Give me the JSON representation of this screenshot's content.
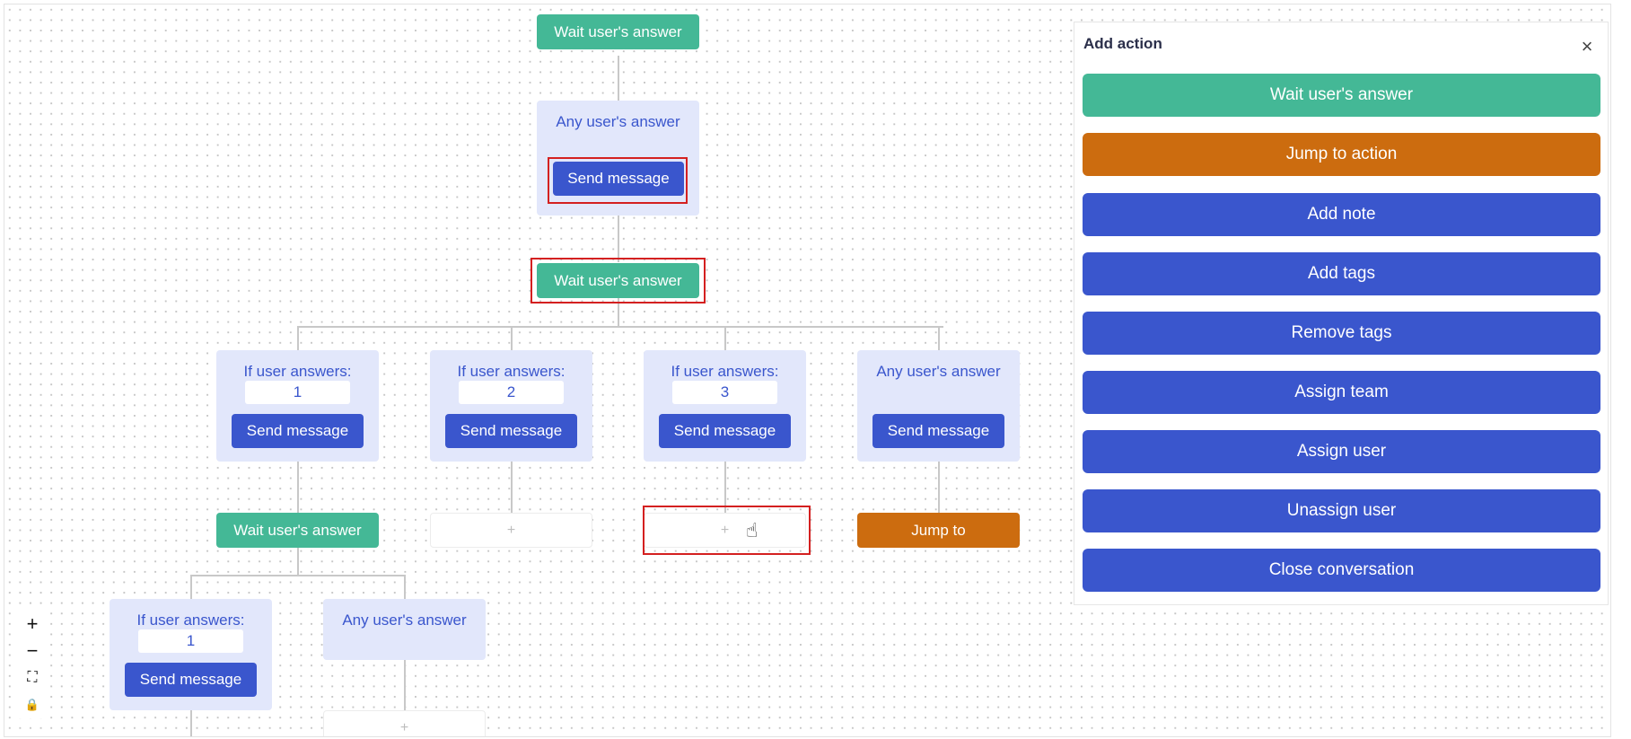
{
  "flow": {
    "top_wait_label": "Wait user's answer",
    "any_answer_label": "Any user's answer",
    "send_message_label": "Send message",
    "if_answers_label": "If user answers:",
    "jump_to_label": "Jump to",
    "placeholder_plus": "+",
    "answers": [
      "1",
      "2",
      "3",
      "1"
    ]
  },
  "zoom_controls": {
    "zoom_in": "+",
    "zoom_out": "−",
    "fit": "⛶",
    "lock": "🔒"
  },
  "panel": {
    "title": "Add action",
    "close": "×",
    "actions": [
      {
        "label": "Wait user's answer",
        "color": "#44b896"
      },
      {
        "label": "Jump to action",
        "color": "#cc6c0f"
      },
      {
        "label": "Add note",
        "color": "#3a56cd"
      },
      {
        "label": "Add tags",
        "color": "#3a56cd"
      },
      {
        "label": "Remove tags",
        "color": "#3a56cd"
      },
      {
        "label": "Assign team",
        "color": "#3a56cd"
      },
      {
        "label": "Assign user",
        "color": "#3a56cd"
      },
      {
        "label": "Unassign user",
        "color": "#3a56cd"
      },
      {
        "label": "Close conversation",
        "color": "#3a56cd"
      }
    ]
  }
}
